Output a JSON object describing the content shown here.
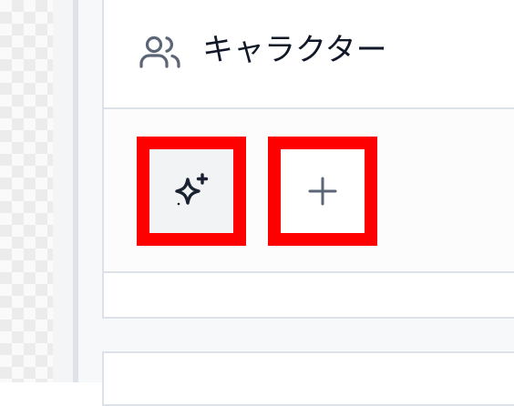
{
  "section": {
    "title": "キャラクター",
    "icon": "users-icon"
  },
  "actions": {
    "generate": {
      "icon": "sparkles-icon"
    },
    "add": {
      "icon": "plus-icon"
    }
  },
  "colors": {
    "highlight": "#ff0000",
    "title": "#111827",
    "icon": "#5b6575",
    "border": "#dde2e8"
  }
}
